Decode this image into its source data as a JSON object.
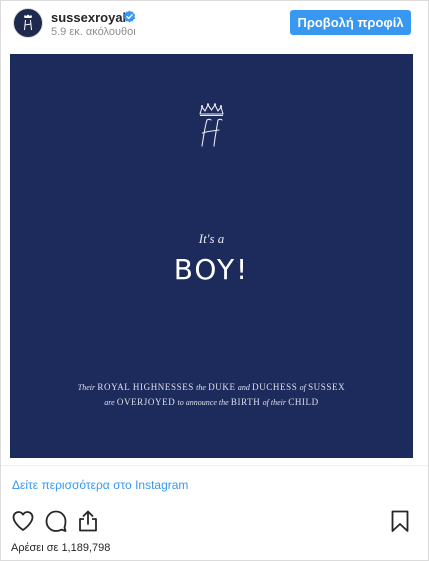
{
  "header": {
    "username": "sussexroyal",
    "followers_text": "5.9 εκ. ακόλουθοι",
    "profile_button_label": "Προβολή προφίλ"
  },
  "post": {
    "image": {
      "background_color": "#1d2a5c",
      "subtitle": "It's a",
      "headline": "BOY!",
      "announcement_line1": [
        {
          "text": "Their",
          "style": "italic"
        },
        {
          "text": "ROYAL HIGHNESSES",
          "style": "caps"
        },
        {
          "text": "the",
          "style": "italic"
        },
        {
          "text": "DUKE",
          "style": "caps"
        },
        {
          "text": "and",
          "style": "italic"
        },
        {
          "text": "DUCHESS",
          "style": "caps"
        },
        {
          "text": "of",
          "style": "italic"
        },
        {
          "text": "SUSSEX",
          "style": "caps"
        }
      ],
      "announcement_line2": [
        {
          "text": "are",
          "style": "italic"
        },
        {
          "text": "OVERJOYED",
          "style": "caps"
        },
        {
          "text": "to announce the",
          "style": "italic"
        },
        {
          "text": "BIRTH",
          "style": "caps"
        },
        {
          "text": "of their",
          "style": "italic"
        },
        {
          "text": "CHILD",
          "style": "caps"
        }
      ]
    },
    "see_more_link": "Δείτε περισσότερα στο Instagram",
    "likes_text": "Αρέσει σε 1,189,798"
  },
  "icons": {
    "verified": "verified-badge-icon",
    "like": "heart-icon",
    "comment": "comment-bubble-icon",
    "share": "share-icon",
    "save": "bookmark-icon"
  },
  "colors": {
    "accent": "#3897f0",
    "text": "#262626",
    "muted": "#8e8e8e"
  }
}
